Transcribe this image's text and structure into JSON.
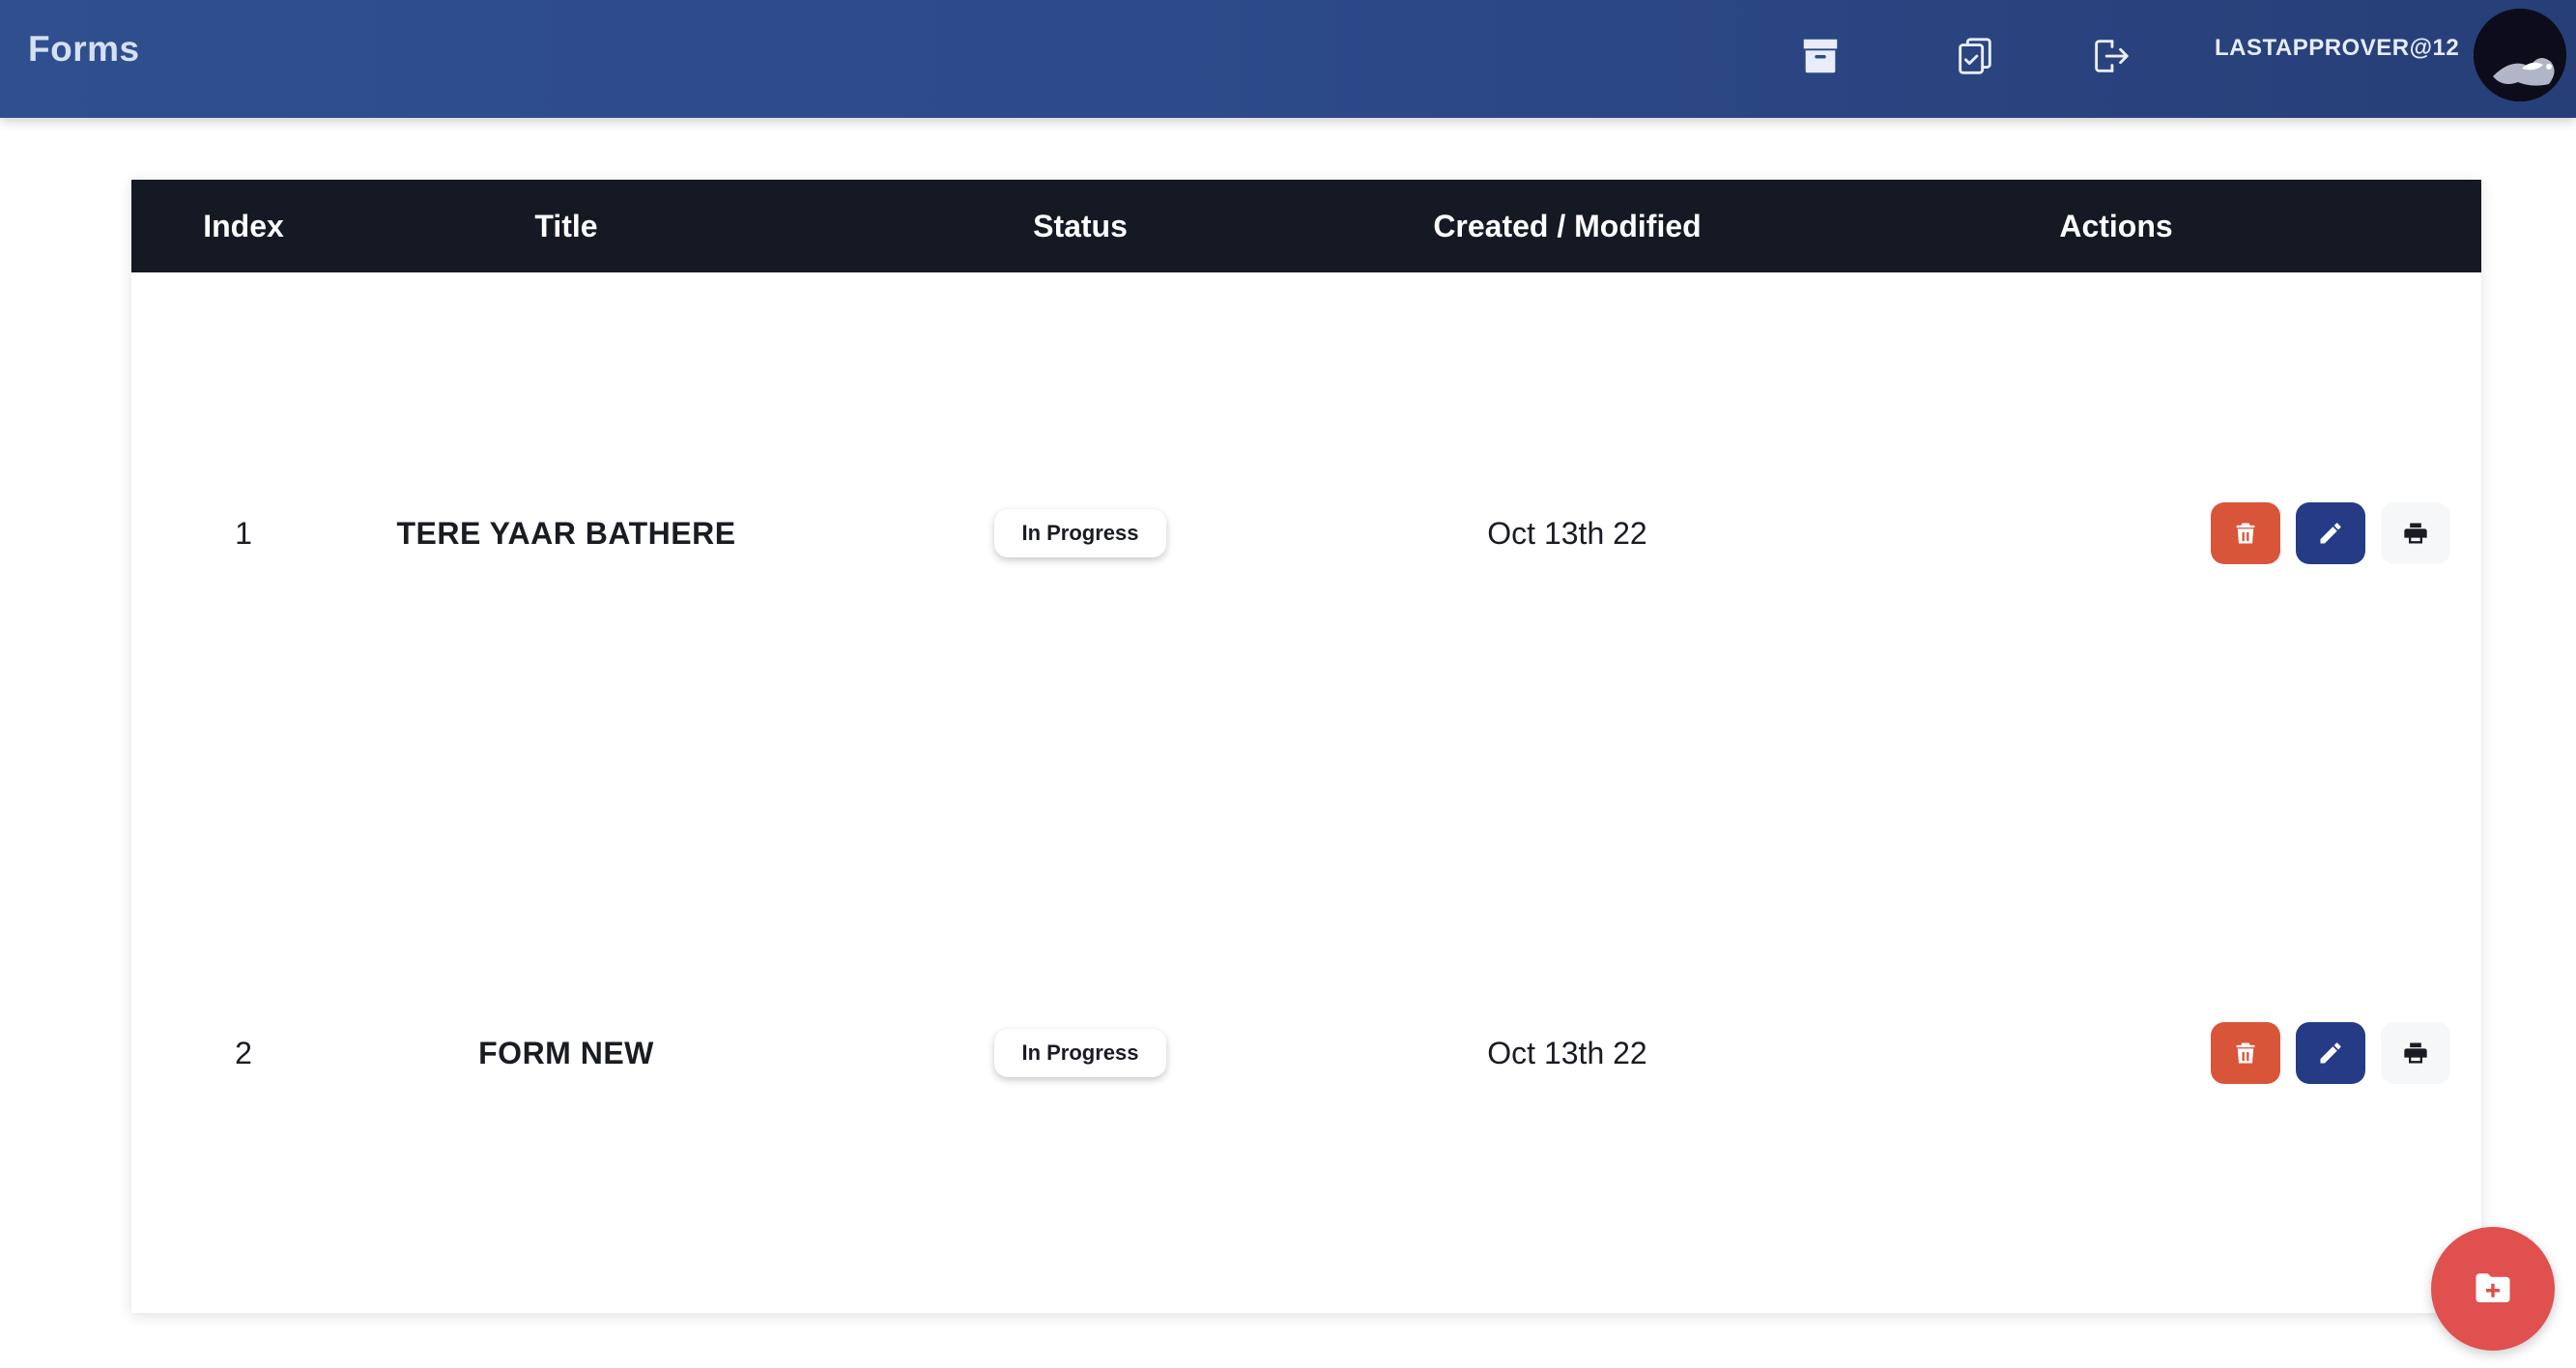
{
  "header": {
    "title": "Forms",
    "nav_icons": [
      "archive-icon",
      "clipboard-check-icon",
      "logout-icon"
    ],
    "user": "LASTAPPROVER@12"
  },
  "table": {
    "columns": [
      "Index",
      "Title",
      "Status",
      "Created / Modified",
      "Actions"
    ],
    "rows": [
      {
        "index": "1",
        "title": "TERE YAAR BATHERE",
        "status": "In Progress",
        "date": "Oct 13th 22"
      },
      {
        "index": "2",
        "title": "FORM NEW",
        "status": "In Progress",
        "date": "Oct 13th 22"
      }
    ],
    "action_icons": [
      "trash-icon",
      "pencil-icon",
      "printer-icon"
    ]
  },
  "fab": {
    "icon": "folder-plus-icon"
  },
  "colors": {
    "header_bg": "#2d4a8a",
    "table_header_bg": "#141924",
    "delete": "#d9553a",
    "edit": "#253b86",
    "print": "#f6f7f9",
    "fab": "#e0504f"
  }
}
